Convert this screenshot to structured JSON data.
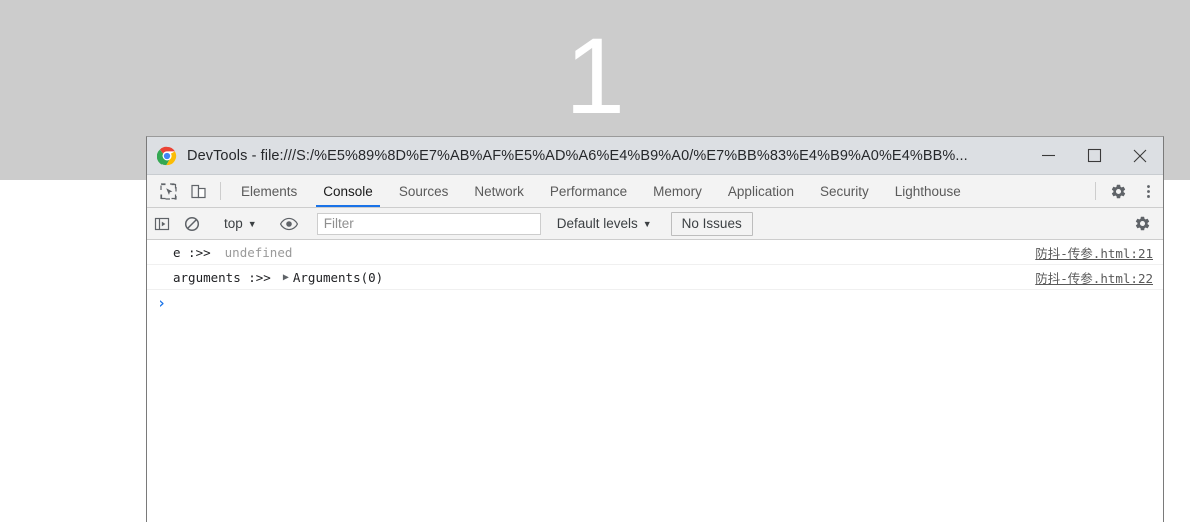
{
  "background_page": {
    "number": "1",
    "gray_band_color": "#cccccc",
    "number_color": "#ffffff"
  },
  "window": {
    "title": "DevTools - file:///S:/%E5%89%8D%E7%AB%AF%E5%AD%A6%E4%B9%A0/%E7%BB%83%E4%B9%A0%E4%BB%...",
    "logo": "chrome-logo",
    "controls": {
      "minimize": "minimize-icon",
      "maximize": "maximize-icon",
      "close": "close-icon"
    }
  },
  "tabbar": {
    "inspect_icon": "inspect-element-icon",
    "device_icon": "device-toolbar-icon",
    "tabs": [
      {
        "label": "Elements",
        "active": false
      },
      {
        "label": "Console",
        "active": true
      },
      {
        "label": "Sources",
        "active": false
      },
      {
        "label": "Network",
        "active": false
      },
      {
        "label": "Performance",
        "active": false
      },
      {
        "label": "Memory",
        "active": false
      },
      {
        "label": "Application",
        "active": false
      },
      {
        "label": "Security",
        "active": false
      },
      {
        "label": "Lighthouse",
        "active": false
      }
    ],
    "settings_icon": "gear-icon",
    "more_icon": "more-vertical-icon",
    "active_tab_color": "#1a73e8"
  },
  "filterbar": {
    "sidebar_icon": "console-sidebar-icon",
    "clear_icon": "clear-console-icon",
    "context": "top",
    "context_caret": "▼",
    "eye_icon": "live-expression-eye-icon",
    "filter_placeholder": "Filter",
    "filter_value": "",
    "levels": "Default levels",
    "levels_caret": "▼",
    "issues_label": "No Issues",
    "settings_icon": "gear-icon"
  },
  "console": {
    "messages": [
      {
        "label": "e :>>",
        "value": "undefined",
        "value_kind": "undefined",
        "expandable": false,
        "source": "防抖-传参.html:21"
      },
      {
        "label": "arguments :>>",
        "value": "Arguments(0)",
        "value_kind": "object",
        "expandable": true,
        "disclosure": "▶",
        "source": "防抖-传参.html:22"
      }
    ],
    "prompt_caret": "›",
    "prompt_color": "#1a73e8"
  }
}
